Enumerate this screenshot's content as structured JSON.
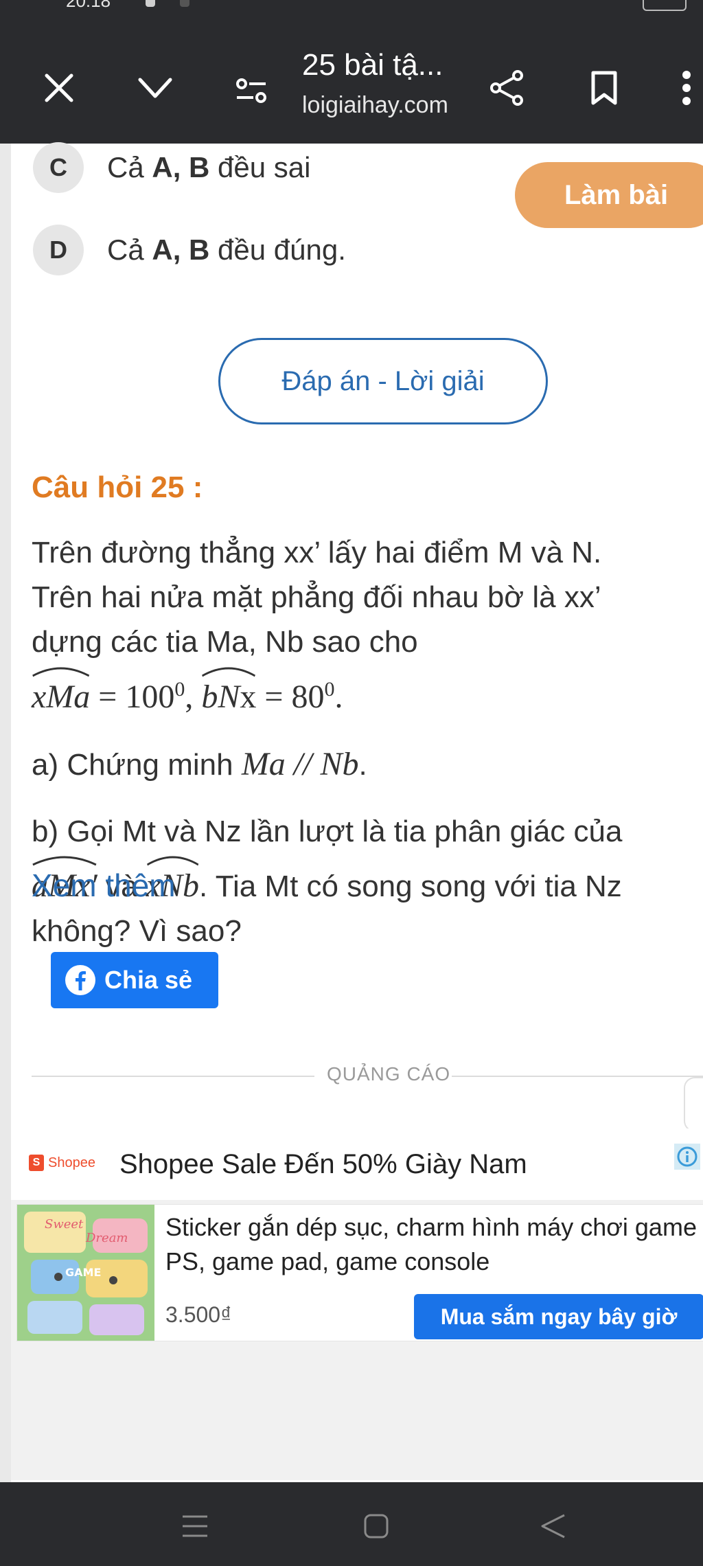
{
  "status_bar": {
    "time": "20:18"
  },
  "toolbar": {
    "title": "25 bài tậ...",
    "url": "loigiaihay.com",
    "icons": [
      "close-icon",
      "chevron-down-icon",
      "reader-settings-icon",
      "share-icon",
      "bookmark-icon",
      "more-vert-icon"
    ]
  },
  "options": [
    {
      "letter": "C",
      "pre": "Cả ",
      "bold": "A, B",
      "post": " đều sai"
    },
    {
      "letter": "D",
      "pre": "Cả ",
      "bold": "A, B",
      "post": " đều đúng."
    }
  ],
  "lam_bai": "Làm bài",
  "dap_an_button": "Đáp án - Lời giải",
  "question": {
    "title": "Câu hỏi 25 :",
    "line1": "Trên đường thẳng xx’ lấy hai điểm M và N.",
    "line2": "Trên hai nửa mặt phẳng đối nhau bờ là xx’",
    "line3": "dựng các tia Ma, Nb sao cho",
    "angle1": "xMa",
    "eq1": " = 100",
    "sup1": "0",
    "comma": ", ",
    "angle2_ital": "bN",
    "angle2_up": "x",
    "eq2": " = 80",
    "sup2": "0",
    "end_dot": ".",
    "part_a_text": "a) Chứng minh ",
    "part_a_math": "Ma // Nb",
    "part_a_end": ".",
    "part_b_line1": "b) Gọi Mt và Nz lần lượt là tia phân giác của",
    "part_b_angle1": "aMx′",
    "part_b_va": " và ",
    "part_b_angle2": "xNb",
    "part_b_rest": ". Tia Mt có song song với tia Nz",
    "part_b_line3": "không? Vì sao?"
  },
  "see_more": "Xem thêm",
  "share_button": "Chia sẻ",
  "ad": {
    "label": "QUẢNG CÁO",
    "brand": "Shopee",
    "title": "Shopee Sale Đến 50% Giày Nam",
    "description": "Sticker gắn dép sục, charm hình máy chơi game PS, game pad, game console",
    "price": "3.500₫",
    "cta": "Mua sắm ngay bây giờ",
    "thumb_text_1": "Sweet",
    "thumb_text_2": "Dream",
    "thumb_text_3": "GAME"
  },
  "nav_bar": {
    "icons": [
      "menu-icon",
      "home-icon",
      "back-icon"
    ]
  }
}
